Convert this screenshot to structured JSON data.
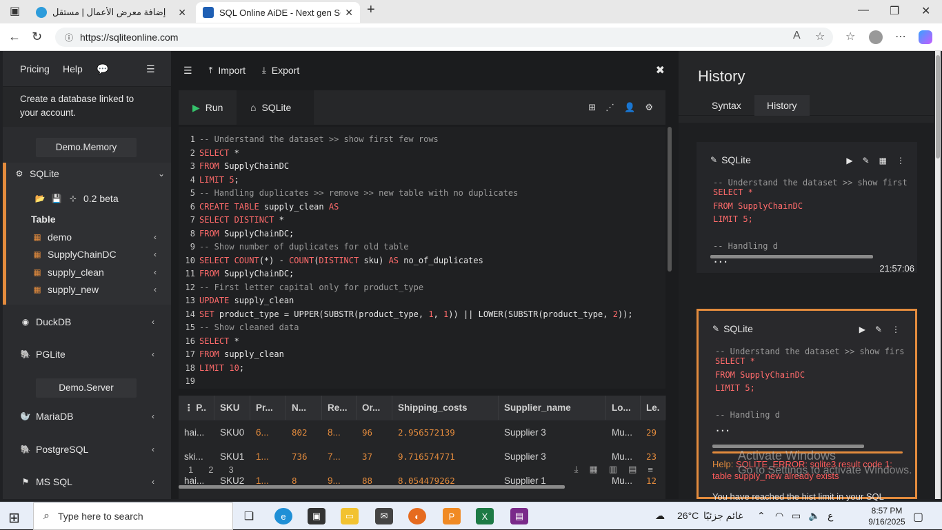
{
  "browser": {
    "tab_inactive_title": "إضافة معرض الأعمال | مستقل",
    "tab_active_title": "SQL Online AiDE - Next gen SQL",
    "url": "https://sqliteonline.com"
  },
  "sidebar": {
    "pricing": "Pricing",
    "help": "Help",
    "message": "Create a database linked to your account.",
    "demo_memory": "Demo.Memory",
    "sqlite": "SQLite",
    "version": "0.2 beta",
    "table_label": "Table",
    "tables": [
      "demo",
      "SupplyChainDC",
      "supply_clean",
      "supply_new"
    ],
    "duckdb": "DuckDB",
    "pglite": "PGLite",
    "demo_server": "Demo.Server",
    "mariadb": "MariaDB",
    "postgresql": "PostgreSQL",
    "mssql": "MS SQL"
  },
  "toolbar": {
    "import": "Import",
    "export": "Export",
    "run": "Run",
    "sqlite_tab": "SQLite"
  },
  "editor": {
    "line_numbers": [
      "1",
      "2",
      "3",
      "4",
      "5",
      "6",
      "7",
      "8",
      "9",
      "10",
      "11",
      "12",
      "13",
      "14",
      "15",
      "16",
      "17",
      "18",
      "19"
    ]
  },
  "results": {
    "headers": [
      "P..",
      "SKU",
      "Pr...",
      "N...",
      "Re...",
      "Or...",
      "Shipping_costs",
      "Supplier_name",
      "Lo...",
      "Le."
    ],
    "rows": [
      [
        "hai...",
        "SKU0",
        "6...",
        "802",
        "8...",
        "96",
        "2.956572139",
        "Supplier 3",
        "Mu...",
        "29"
      ],
      [
        "ski...",
        "SKU1",
        "1...",
        "736",
        "7...",
        "37",
        "9.716574771",
        "Supplier 3",
        "Mu...",
        "23"
      ],
      [
        "hai...",
        "SKU2",
        "1...",
        "8",
        "9...",
        "88",
        "8.054479262",
        "Supplier 1",
        "Mu...",
        "12"
      ]
    ],
    "pages": [
      "1",
      "2",
      "3"
    ]
  },
  "history": {
    "title": "History",
    "tab_syntax": "Syntax",
    "tab_history": "History",
    "card1_engine": "SQLite",
    "card1_time": "21:57:06",
    "card2_engine": "SQLite",
    "card1_code": [
      "-- Understand the dataset >> show first",
      "SELECT *",
      "FROM SupplyChainDC",
      "LIMIT 5;",
      "",
      "-- Handling d",
      "..."
    ],
    "card2_code": [
      "-- Understand the dataset >> show firs",
      "SELECT *",
      "FROM SupplyChainDC",
      "LIMIT 5;",
      "",
      "-- Handling d",
      "..."
    ],
    "error_label": "Help:",
    "error_text": "SQLITE_ERROR: sqlite3 result code 1: table supply_new already exists",
    "note": "You have reached the hist limit in your SQL"
  },
  "watermark": {
    "line1": "Activate Windows",
    "line2": "Go to Settings to activate Windows."
  },
  "taskbar": {
    "search_placeholder": "Type here to search",
    "temperature": "26°C",
    "weather": "غائم جزئيًا",
    "lang": "ع",
    "time": "8:57 PM",
    "date": "9/16/2025"
  },
  "colors": {
    "accent": "#e38b3d",
    "run_green": "#35c26b",
    "error_red": "#ff5b5b",
    "keyword": "#ff6b6b"
  }
}
